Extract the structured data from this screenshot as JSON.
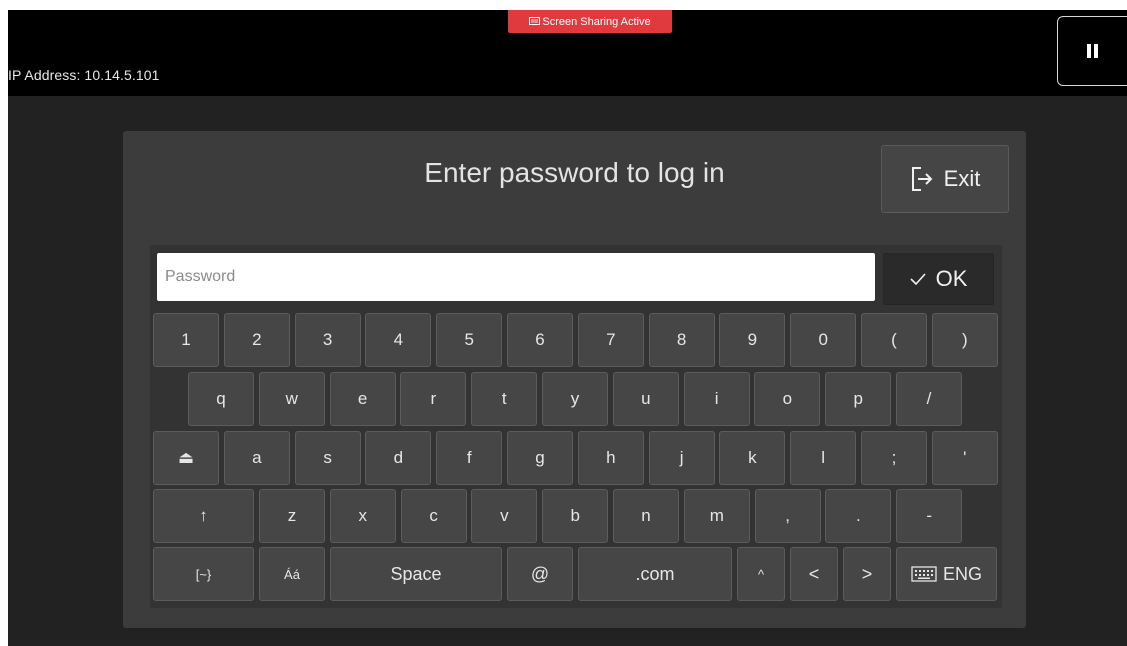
{
  "topbar": {
    "ip_label": "IP Address: 10.14.5.101",
    "share_badge": "Screen Sharing Active",
    "share_icon": "screen-share-icon",
    "pause_icon": "pause-icon"
  },
  "dialog": {
    "title": "Enter password to log in",
    "exit_label": "Exit",
    "exit_icon": "exit-arrow-icon"
  },
  "password": {
    "placeholder": "Password",
    "value": ""
  },
  "ok": {
    "label": "OK",
    "icon": "checkmark-icon"
  },
  "keyboard": {
    "row1": [
      "1",
      "2",
      "3",
      "4",
      "5",
      "6",
      "7",
      "8",
      "9",
      "0",
      "(",
      ")"
    ],
    "row2": [
      "q",
      "w",
      "e",
      "r",
      "t",
      "y",
      "u",
      "i",
      "o",
      "p",
      "/"
    ],
    "row3": [
      "⏏",
      "a",
      "s",
      "d",
      "f",
      "g",
      "h",
      "j",
      "k",
      "l",
      ";",
      "'"
    ],
    "row4": [
      "↑",
      "z",
      "x",
      "c",
      "v",
      "b",
      "n",
      "m",
      ",",
      ".",
      "-"
    ],
    "row5": {
      "symbols": "[~}",
      "accents": "Áá",
      "space": "Space",
      "at": "@",
      "dotcom": ".com",
      "caret": "^",
      "left": "<",
      "right": ">",
      "lang": "ENG",
      "lang_icon": "keyboard-icon"
    }
  },
  "colors": {
    "badge": "#e03a3f",
    "dialog": "#3c3c3c",
    "key": "#464646",
    "background": "#222222"
  }
}
